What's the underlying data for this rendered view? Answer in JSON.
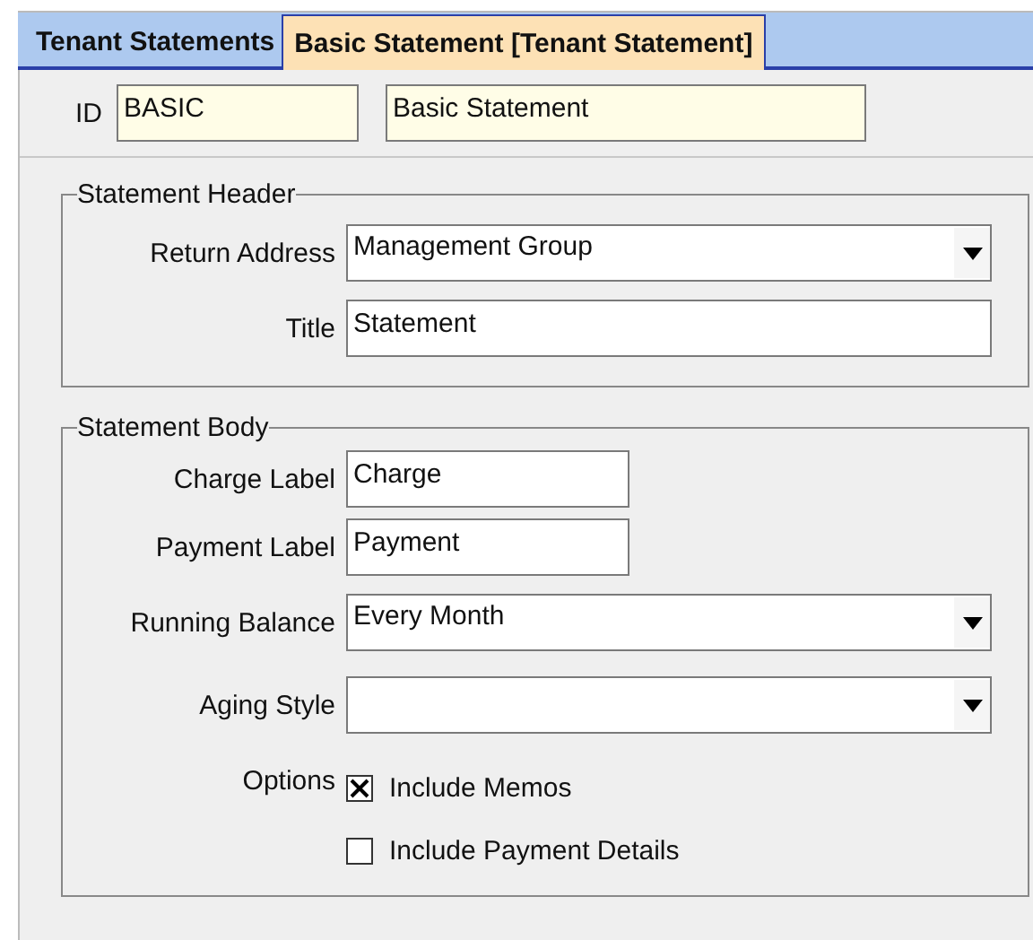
{
  "tabs": [
    {
      "label": "Tenant Statements",
      "selected": false
    },
    {
      "label": "Basic Statement  [Tenant Statement]",
      "selected": true
    }
  ],
  "id_row": {
    "label": "ID",
    "id_value": "BASIC",
    "name_value": "Basic Statement"
  },
  "groups": [
    {
      "title": "Statement Header",
      "fields": [
        {
          "kind": "combo",
          "label": "Return Address",
          "value": "Management Group"
        },
        {
          "kind": "wide",
          "label": "Title",
          "value": "Statement"
        }
      ]
    },
    {
      "title": "Statement Body",
      "fields": [
        {
          "kind": "short",
          "label": "Charge Label",
          "value": "Charge"
        },
        {
          "kind": "short",
          "label": "Payment Label",
          "value": "Payment"
        },
        {
          "kind": "combo",
          "label": "Running Balance",
          "value": "Every Month"
        },
        {
          "kind": "combo",
          "label": "Aging Style"
        },
        {
          "kind": "checks",
          "label": "Options",
          "options": [
            {
              "label": "Include Memos",
              "checked": true
            },
            {
              "label": "Include Payment Details",
              "checked": false
            }
          ]
        }
      ]
    }
  ]
}
